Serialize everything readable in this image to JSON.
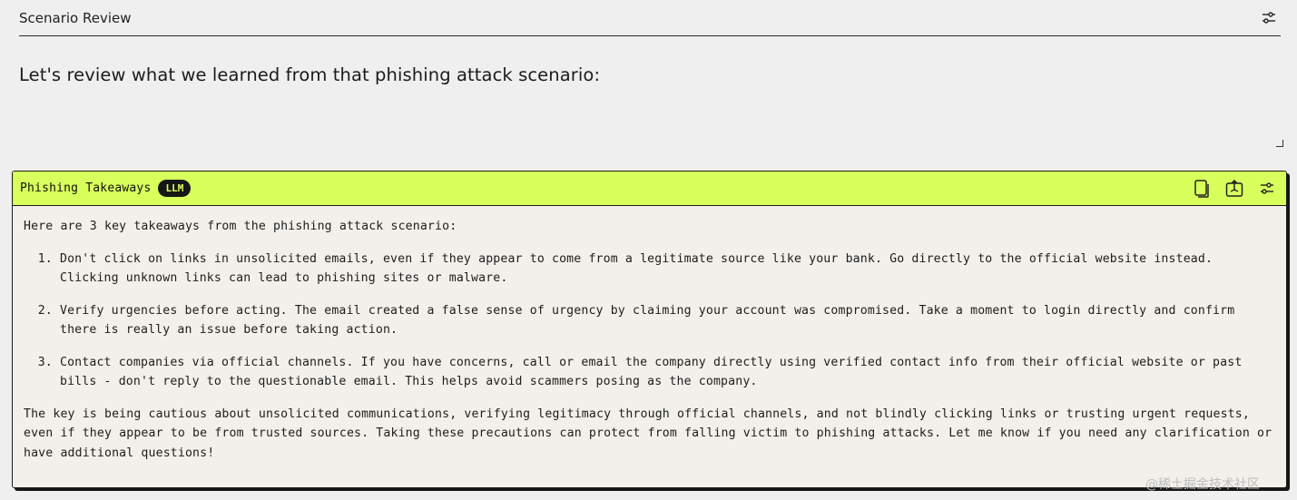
{
  "top": {
    "title": "Scenario Review",
    "prompt": "Let's review what we learned from that phishing attack scenario:",
    "settings_icon": "sliders-icon"
  },
  "llm": {
    "title": "Phishing Takeaways",
    "badge": "LLM",
    "actions": [
      "copy-icon",
      "export-icon",
      "sliders-icon"
    ],
    "intro": "Here are 3 key takeaways from the phishing attack scenario:",
    "items": [
      "Don't click on links in unsolicited emails, even if they appear to come from a legitimate source like your bank. Go directly to the official website instead. Clicking unknown links can lead to phishing sites or malware.",
      "Verify urgencies before acting. The email created a false sense of urgency by claiming your account was compromised. Take a moment to login directly and confirm there is really an issue before taking action.",
      "Contact companies via official channels. If you have concerns, call or email the company directly using verified contact info from their official website or past bills - don't reply to the questionable email. This helps avoid scammers posing as the company."
    ],
    "conclusion": "The key is being cautious about unsolicited communications, verifying legitimacy through official channels, and not blindly clicking links or trusting urgent requests, even if they appear to be from trusted sources. Taking these precautions can protect from falling victim to phishing attacks. Let me know if you need any clarification or have additional questions!"
  },
  "watermark": "@稀土掘金技术社区",
  "colors": {
    "accent": "#d8ff5c",
    "background": "#efefef",
    "card": "#f2f0ea",
    "badge": "#161616"
  }
}
